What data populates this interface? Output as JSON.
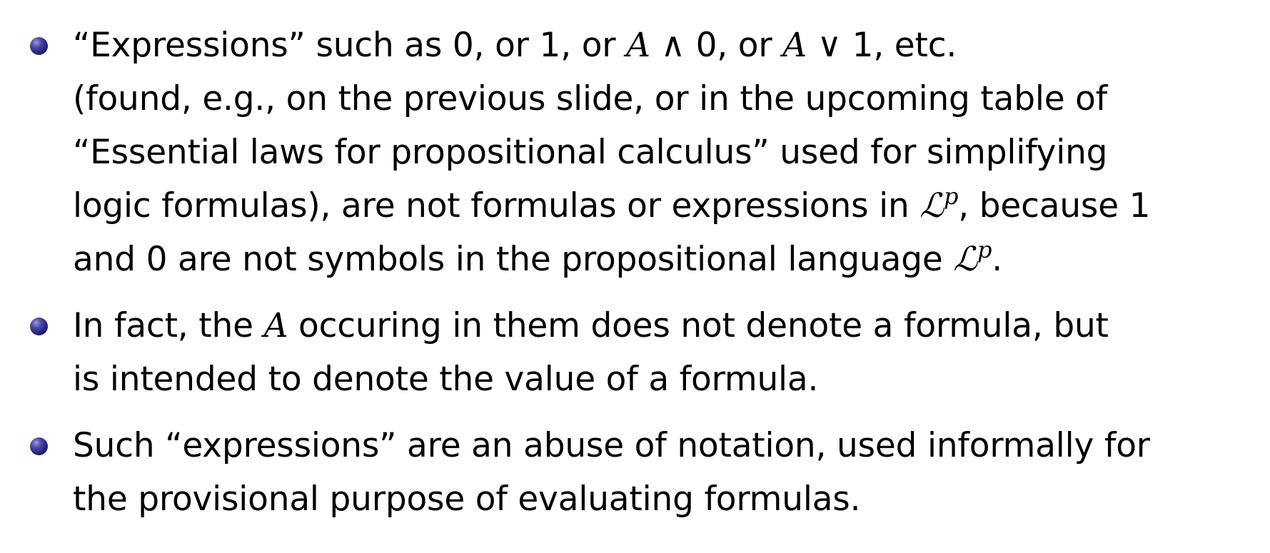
{
  "bullets": [
    {
      "lines": [
        {
          "t1": "“Expressions” such as 0, or 1, or ",
          "v1": "A",
          "op1": " ∧ ",
          "t2": "0, or ",
          "v2": "A",
          "op2": " ∨ ",
          "t3": "1, etc."
        },
        {
          "text": "(found, e.g., on the previous slide, or in the upcoming table of"
        },
        {
          "text": "“Essential laws for propositional calculus” used for simplifying"
        },
        {
          "t1": "logic formulas), are not formulas or expressions in ",
          "lang": "ℒ",
          "sup": "p",
          "t2": ", because 1"
        },
        {
          "t1": "and 0 are not symbols in the propositional language ",
          "lang": "ℒ",
          "sup": "p",
          "t2": "."
        }
      ]
    },
    {
      "lines": [
        {
          "t1": "In fact, the ",
          "v1": "A",
          "t2": " occuring in them does not denote a formula, but"
        },
        {
          "text": "is intended to denote the value of a formula."
        }
      ]
    },
    {
      "lines": [
        {
          "text": "Such “expressions” are an abuse of notation, used informally for"
        },
        {
          "text": "the provisional purpose of evaluating formulas."
        }
      ]
    }
  ]
}
